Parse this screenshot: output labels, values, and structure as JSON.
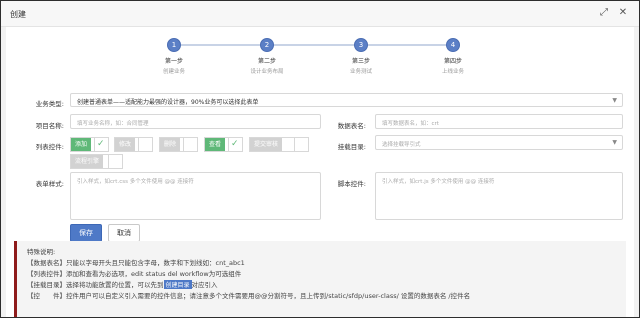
{
  "window": {
    "title": "创建",
    "maximize_icon": "maximize-icon",
    "close_icon": "close-icon"
  },
  "steps": [
    {
      "num": "1",
      "name": "第一步",
      "desc": "创建业务"
    },
    {
      "num": "2",
      "name": "第二步",
      "desc": "设计业务布局"
    },
    {
      "num": "3",
      "name": "第三步",
      "desc": "业务测试"
    },
    {
      "num": "4",
      "name": "第四步",
      "desc": "上线业务"
    }
  ],
  "form": {
    "business_type": {
      "label": "业务类型:",
      "value": "创建普通表单——适配能力最强的设计器，90%业务可以选择此表单"
    },
    "project_name": {
      "label": "项目名称:",
      "placeholder": "填写业务名称，如：合同管理"
    },
    "table_name": {
      "label": "数据表名:",
      "placeholder": "填写数据表名，如：crt"
    },
    "list_controls": {
      "label": "列表控件:",
      "items": [
        {
          "label": "添加",
          "checked": true
        },
        {
          "label": "修改",
          "checked": false
        },
        {
          "label": "删除",
          "checked": false
        },
        {
          "label": "查看",
          "checked": true
        },
        {
          "label": "提交审核",
          "checked": false
        },
        {
          "label": "流程引擎",
          "checked": false
        }
      ]
    },
    "mount_dir": {
      "label": "挂载目录:",
      "placeholder": "选择挂载导引式"
    },
    "form_style": {
      "label": "表单样式:",
      "placeholder": "引入样式，如crt.css 多个文件使用 @@ 连接符"
    },
    "script_control": {
      "label": "脚本控件:",
      "placeholder": "引入样式，如crt.js 多个文件使用 @@ 连接符"
    }
  },
  "buttons": {
    "save": "保存",
    "cancel": "取消"
  },
  "notes": {
    "title": "特殊说明:",
    "line1": "【数据表名】只能以字母开头且只能包含字母，数字和下划线如：cnt_abc1",
    "line2": "【列表控件】添加和查看为必选项，edit status del workflow为可选组件",
    "line3_a": "【挂载目录】选择将功能放置的位置，可以先到",
    "line3_tag": "创建目录",
    "line3_b": "对应引入",
    "line4": "【控　　件】控件用户可以自定义引入需要的控件信息；请注意多个文件需要用@@分割符号，且上传到/static/sfdp/user-class/ 设置的数据表名 /控件名"
  },
  "colors": {
    "accent": "#4e79c7",
    "toggle_on": "#5fb878",
    "note_border": "#8e1b1b"
  }
}
